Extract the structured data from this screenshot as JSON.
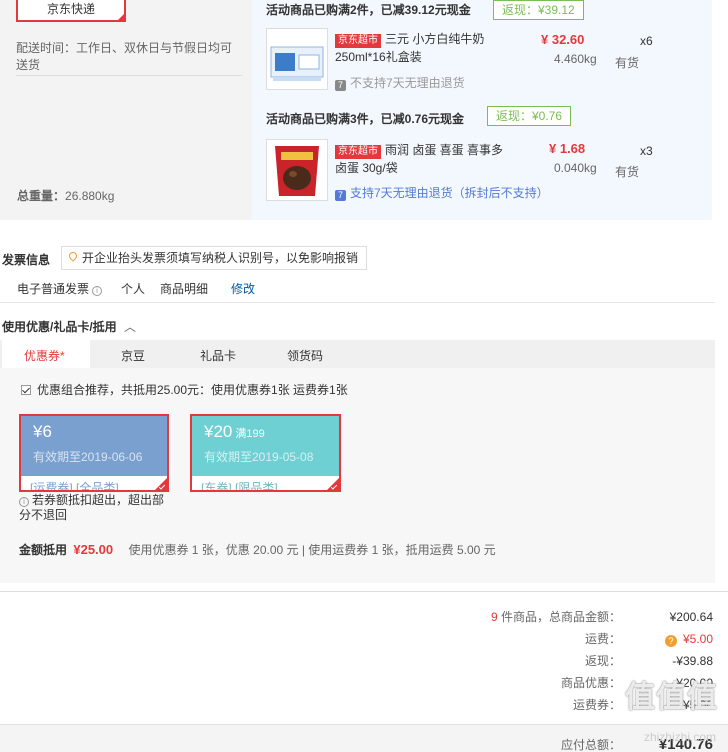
{
  "shipping": {
    "method": "京东快递",
    "time_label": "配送时间：工作日、双休日与节假日均可送货",
    "weight_label": "总重量：",
    "weight_value": "26.880kg"
  },
  "promos": [
    {
      "title": "活动商品已购满2件，已减39.12元现金",
      "rebate": "返现：¥39.12",
      "item": {
        "tag": "京东超市",
        "name_line1": "三元 小方白纯牛奶",
        "name_line2": "250ml*16礼盒装",
        "price": "¥ 32.60",
        "qty": "x6",
        "weight": "4.460kg",
        "stock": "有货",
        "return_policy": "不支持7天无理由退货"
      }
    },
    {
      "title": "活动商品已购满3件，已减0.76元现金",
      "rebate": "返现：¥0.76",
      "item": {
        "tag": "京东超市",
        "name_line1": "雨润 卤蛋 喜蛋 喜事多",
        "name_line2": "卤蛋 30g/袋",
        "price": "¥ 1.68",
        "qty": "x3",
        "weight": "0.040kg",
        "stock": "有货",
        "return_policy": "支持7天无理由退货（拆封后不支持）"
      }
    }
  ],
  "invoice": {
    "title": "发票信息",
    "tip": "开企业抬头发票须填写纳税人识别号，以免影响报销",
    "type": "电子普通发票",
    "holder": "个人",
    "content": "商品明细",
    "edit": "修改"
  },
  "coupons": {
    "title": "使用优惠/礼品卡/抵用",
    "toggle": "^",
    "tabs": [
      "优惠券*",
      "京豆",
      "礼品卡",
      "领货码"
    ],
    "combo_text": "优惠组合推荐，共抵用25.00元：使用优惠券1张 运费券1张",
    "cards": [
      {
        "amount": "¥6",
        "condition": "",
        "valid": "有效期至2019-06-06",
        "scope": "[运费券] [全品类]"
      },
      {
        "amount": "¥20",
        "condition": "满199",
        "valid": "有效期至2019-05-08",
        "scope": "[东券] [限品类]"
      }
    ],
    "warning": "若券额抵扣超出，超出部分不退回",
    "deduct_label": "金额抵用",
    "deduct_value": "¥25.00",
    "deduct_detail": "使用优惠券 1 张，优惠 20.00 元 | 使用运费券 1 张，抵用运费 5.00 元"
  },
  "summary": {
    "count": "9",
    "count_suffix": "件商品，总商品金额：",
    "goods_total": "¥200.64",
    "shipping_label": "运费：",
    "shipping_value": "¥5.00",
    "rebate_label": "返现：",
    "rebate_value": "-¥39.88",
    "discount_label": "商品优惠：",
    "discount_value": "-¥20.00",
    "ship_coupon_label": "运费券：",
    "ship_coupon_value": "-¥5.00",
    "payable_label": "应付总额：",
    "payable_value": "¥140.76"
  },
  "watermark": {
    "text": "值值值",
    "sub": "zhizhizhi.com"
  },
  "colors": {
    "accent": "#e4393c",
    "rebate_green": "#7abd54",
    "coupon_blue": "#7aa0d0",
    "coupon_teal": "#6fd0d4"
  }
}
